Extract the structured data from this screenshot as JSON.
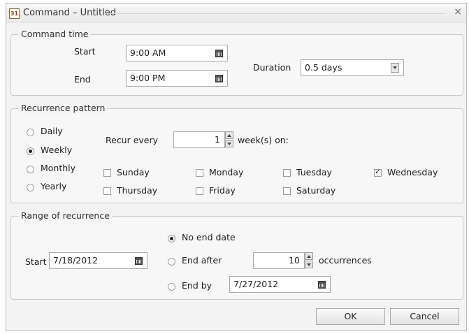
{
  "window": {
    "title": "Command – Untitled",
    "icon_text": "31",
    "close_glyph": "×"
  },
  "command_time": {
    "title": "Command time",
    "start_label": "Start",
    "start_value": "9:00 AM",
    "end_label": "End",
    "end_value": "9:00 PM",
    "duration_label": "Duration",
    "duration_value": "0.5 days"
  },
  "recurrence": {
    "title": "Recurrence pattern",
    "options": [
      {
        "label": "Daily",
        "checked": false
      },
      {
        "label": "Weekly",
        "checked": true
      },
      {
        "label": "Monthly",
        "checked": false
      },
      {
        "label": "Yearly",
        "checked": false
      }
    ],
    "recur_every_label": "Recur every",
    "recur_every_value": "1",
    "weeks_on_label": "week(s) on:",
    "days": [
      {
        "label": "Sunday",
        "checked": false
      },
      {
        "label": "Monday",
        "checked": false
      },
      {
        "label": "Tuesday",
        "checked": false
      },
      {
        "label": "Wednesday",
        "checked": true
      },
      {
        "label": "Thursday",
        "checked": false
      },
      {
        "label": "Friday",
        "checked": false
      },
      {
        "label": "Saturday",
        "checked": false
      }
    ]
  },
  "range": {
    "title": "Range of recurrence",
    "start_label": "Start",
    "start_value": "7/18/2012",
    "no_end_label": "No end date",
    "end_after_label": "End after",
    "end_after_value": "10",
    "occurrences_label": "occurrences",
    "end_by_label": "End by",
    "end_by_value": "7/27/2012",
    "selected": "no_end"
  },
  "buttons": {
    "ok": "OK",
    "cancel": "Cancel"
  }
}
